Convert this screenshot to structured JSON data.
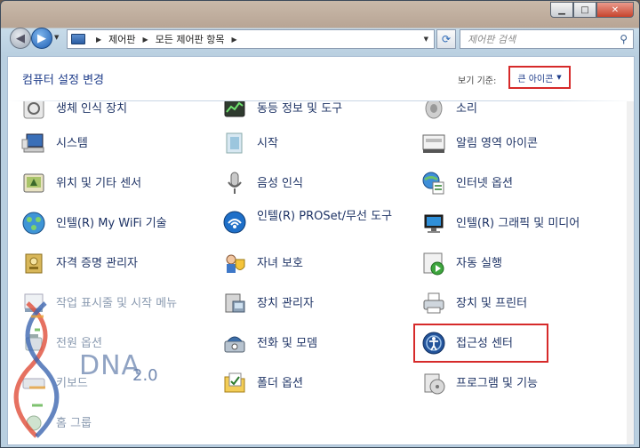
{
  "window": {
    "caption_min": "▁",
    "caption_max": "□",
    "caption_close": "✕"
  },
  "address_bar": {
    "crumbs": [
      "제어판",
      "모든 제어판 항목"
    ],
    "search_placeholder": "제어판 검색"
  },
  "header": {
    "title": "컴퓨터 설정 변경",
    "view_label": "보기 기준:",
    "view_value": "큰 아이콘"
  },
  "items": {
    "row0": [
      "생체 인식 장치",
      "동등 정보 및 도구",
      "소리"
    ],
    "row1": [
      "시스템",
      "시작",
      "알림 영역 아이콘"
    ],
    "row2": [
      "위치 및 기타 센서",
      "음성 인식",
      "인터넷 옵션"
    ],
    "row3": [
      "인텔(R) My WiFi 기술",
      "인텔(R) PROSet/무선 도구",
      "인텔(R) 그래픽 및 미디어"
    ],
    "row4": [
      "자격 증명 관리자",
      "자녀 보호",
      "자동 실행"
    ],
    "row5": [
      "작업 표시줄 및 시작 메뉴",
      "장치 관리자",
      "장치 및 프린터"
    ],
    "row6": [
      "전원 옵션",
      "전화 및 모뎀",
      "접근성 센터"
    ],
    "row7": [
      "키보드",
      "폴더 옵션",
      "프로그램 및 기능"
    ],
    "row8": [
      "홈 그룹"
    ]
  },
  "watermark": {
    "text": "DNA",
    "version": "2.0"
  },
  "colors": {
    "highlight": "#d62a2a",
    "link_text": "#1f3466",
    "title_text": "#1e3c8a"
  }
}
